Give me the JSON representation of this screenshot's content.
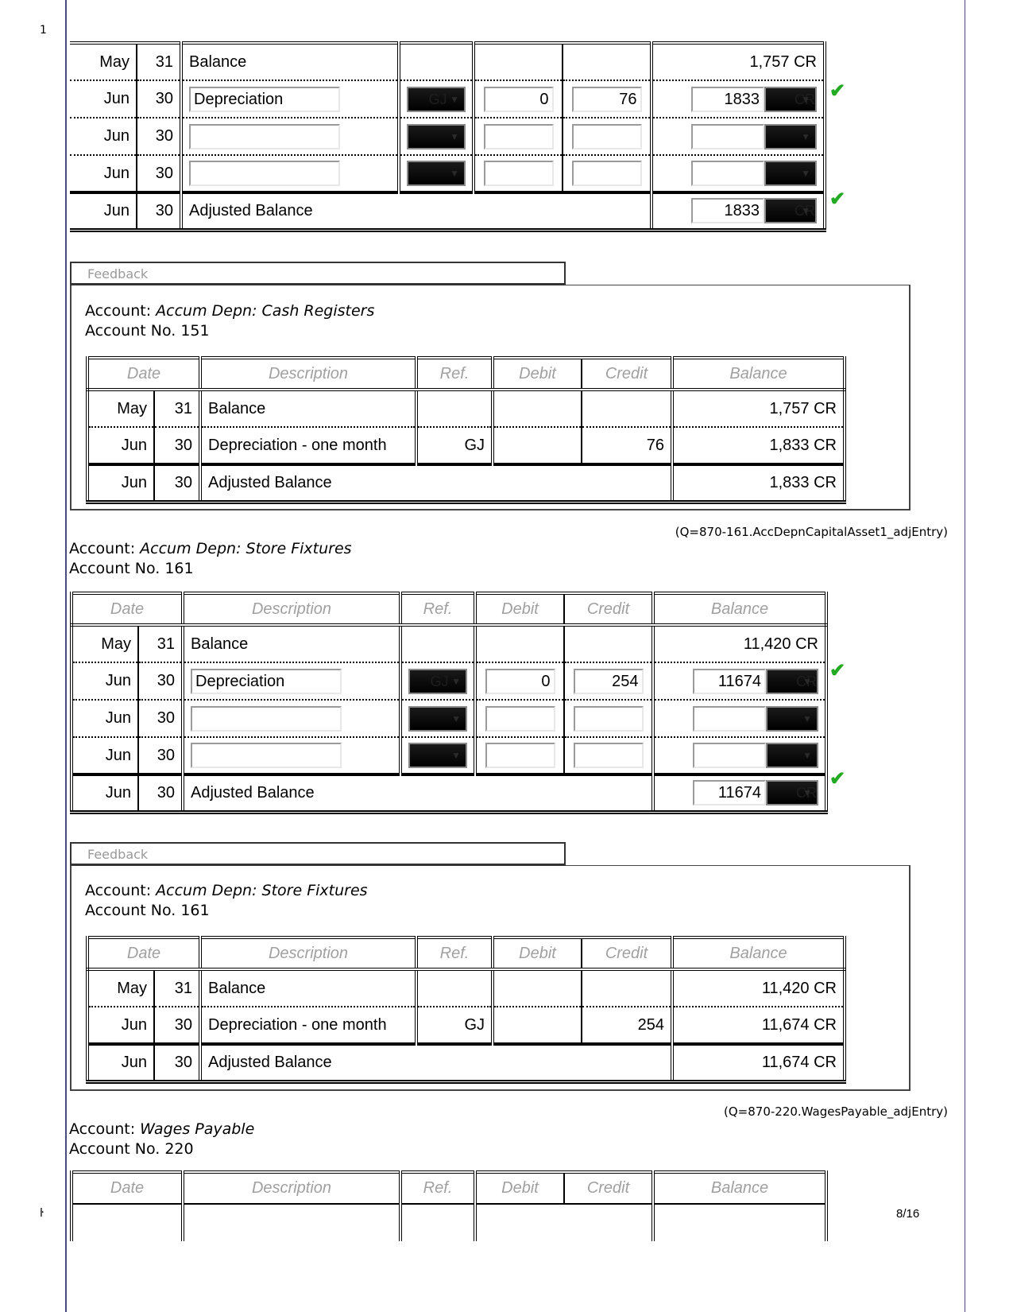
{
  "page": {
    "margin_top_mark": "1",
    "margin_bottom_mark": "ŀ",
    "page_number": "8/16"
  },
  "headers": [
    "Date",
    "Description",
    "Ref.",
    "Debit",
    "Credit",
    "Balance"
  ],
  "section1_entry": {
    "rows": [
      {
        "month": "May",
        "day": "31",
        "description": "Balance",
        "balance": "1,757 CR"
      },
      {
        "month": "Jun",
        "day": "30",
        "description_value": "Depreciation",
        "ref": "GJ",
        "debit": "0",
        "credit": "76",
        "balance_value": "1833",
        "balance_side": "CR",
        "correct": true
      },
      {
        "month": "Jun",
        "day": "30",
        "description_value": "",
        "ref": "",
        "debit": "",
        "credit": "",
        "balance_value": "",
        "balance_side": ""
      },
      {
        "month": "Jun",
        "day": "30",
        "description_value": "",
        "ref": "",
        "debit": "",
        "credit": "",
        "balance_value": "",
        "balance_side": ""
      }
    ],
    "final": {
      "month": "Jun",
      "day": "30",
      "description": "Adjusted Balance",
      "balance_value": "1833",
      "balance_side": "CR",
      "correct": true
    }
  },
  "feedback1": {
    "tab_label": "Feedback",
    "account_label": "Account:",
    "account_name": "Accum Depn: Cash Registers",
    "account_no": "Account No. 151",
    "rows": [
      {
        "month": "May",
        "day": "31",
        "description": "Balance",
        "ref": "",
        "debit": "",
        "credit": "",
        "balance": "1,757 CR"
      },
      {
        "month": "Jun",
        "day": "30",
        "description": "Depreciation - one month",
        "ref": "GJ",
        "debit": "",
        "credit": "76",
        "balance": "1,833 CR"
      }
    ],
    "final": {
      "month": "Jun",
      "day": "30",
      "description": "Adjusted Balance",
      "balance": "1,833 CR"
    }
  },
  "section2": {
    "qref": "(Q=870-161.AccDepnCapitalAsset1_adjEntry)",
    "account_label": "Account:",
    "account_name": "Accum Depn: Store Fixtures",
    "account_no": "Account No. 161",
    "rows": [
      {
        "month": "May",
        "day": "31",
        "description": "Balance",
        "balance": "11,420 CR"
      },
      {
        "month": "Jun",
        "day": "30",
        "description_value": "Depreciation",
        "ref": "GJ",
        "debit": "0",
        "credit": "254",
        "balance_value": "11674",
        "balance_side": "CR",
        "correct": true
      },
      {
        "month": "Jun",
        "day": "30",
        "description_value": "",
        "ref": "",
        "debit": "",
        "credit": "",
        "balance_value": "",
        "balance_side": ""
      },
      {
        "month": "Jun",
        "day": "30",
        "description_value": "",
        "ref": "",
        "debit": "",
        "credit": "",
        "balance_value": "",
        "balance_side": ""
      }
    ],
    "final": {
      "month": "Jun",
      "day": "30",
      "description": "Adjusted Balance",
      "balance_value": "11674",
      "balance_side": "CR",
      "correct": true
    }
  },
  "feedback2": {
    "tab_label": "Feedback",
    "account_label": "Account:",
    "account_name": "Accum Depn: Store Fixtures",
    "account_no": "Account No. 161",
    "rows": [
      {
        "month": "May",
        "day": "31",
        "description": "Balance",
        "ref": "",
        "debit": "",
        "credit": "",
        "balance": "11,420 CR"
      },
      {
        "month": "Jun",
        "day": "30",
        "description": "Depreciation - one month",
        "ref": "GJ",
        "debit": "",
        "credit": "254",
        "balance": "11,674 CR"
      }
    ],
    "final": {
      "month": "Jun",
      "day": "30",
      "description": "Adjusted Balance",
      "balance": "11,674 CR"
    }
  },
  "section3": {
    "qref": "(Q=870-220.WagesPayable_adjEntry)",
    "account_label": "Account:",
    "account_name": "Wages Payable",
    "account_no": "Account No. 220"
  },
  "icons": {
    "check": "✔",
    "dropdown": "▼"
  }
}
